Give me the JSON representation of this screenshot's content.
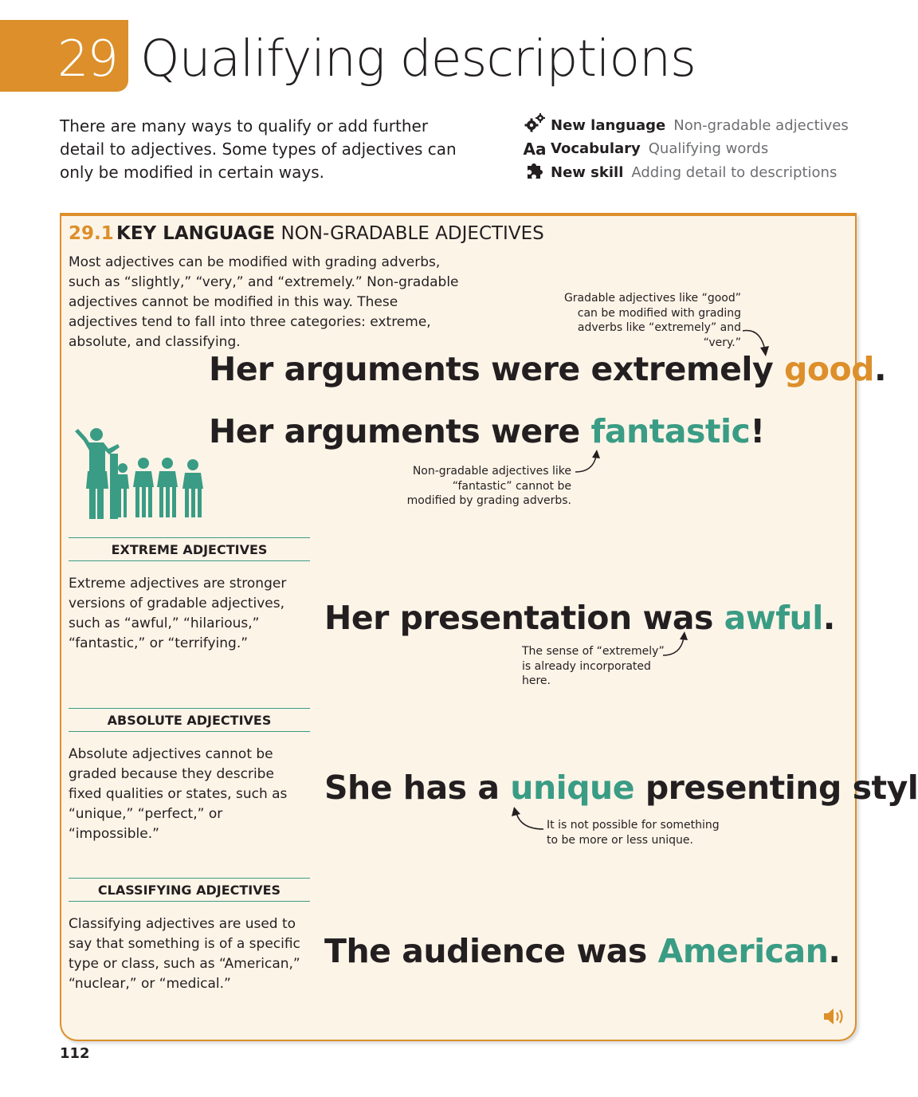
{
  "header": {
    "unit_number": "29",
    "title": "Qualifying descriptions",
    "intro": "There are many ways to qualify or add further detail to adjectives. Some types of adjectives can only be modified in certain ways.",
    "meta": [
      {
        "icon": "gears-icon",
        "key": "New language",
        "value": "Non-gradable adjectives"
      },
      {
        "icon": "aa-icon",
        "icon_text": "Aa",
        "key": "Vocabulary",
        "value": "Qualifying words"
      },
      {
        "icon": "puzzle-icon",
        "key": "New skill",
        "value": "Adding detail to descriptions"
      }
    ]
  },
  "section": {
    "number": "29.1",
    "label": "KEY LANGUAGE",
    "topic": "NON-GRADABLE ADJECTIVES",
    "intro": "Most adjectives can be modified with grading adverbs, such as “slightly,” “very,” and “extremely.” Non-gradable adjectives cannot be modified in this way. These adjectives tend to fall into three categories: extreme, absolute, and classifying.",
    "note_good": "Gradable adjectives like “good” can be modified with grading adverbs like “extremely” and “very.”",
    "sentence1": {
      "before": "Her arguments were extremely ",
      "highlight": "good",
      "after": "."
    },
    "sentence2": {
      "before": "Her arguments were ",
      "highlight": "fantastic",
      "after": "!"
    },
    "note_fantastic": "Non-gradable adjectives like “fantastic” cannot be modified by grading adverbs."
  },
  "categories": [
    {
      "title": "EXTREME ADJECTIVES",
      "text": "Extreme adjectives are stronger versions of gradable adjectives, such as “awful,” “hilarious,” “fantastic,” or “terrifying.”",
      "sentence": {
        "before": "Her presentation was ",
        "highlight": "awful",
        "after": "."
      },
      "note": "The sense of “extremely” is already incorporated here."
    },
    {
      "title": "ABSOLUTE ADJECTIVES",
      "text": "Absolute adjectives cannot be graded because they describe fixed qualities or states, such as “unique,” “perfect,” or “impossible.”",
      "sentence": {
        "before": "She has a ",
        "highlight": "unique",
        "after": " presenting style."
      },
      "note": "It is not possible for something to be more or less unique."
    },
    {
      "title": "CLASSIFYING ADJECTIVES",
      "text": "Classifying adjectives are used to say that something is of a specific type or class, such as “American,” “nuclear,” or “medical.”",
      "sentence": {
        "before": "The audience was ",
        "highlight": "American",
        "after": "."
      }
    }
  ],
  "audio_icon": "speaker-icon",
  "page_number": "112",
  "colors": {
    "accent": "#dc8f2a",
    "teal": "#3a9c84",
    "panel_bg": "#fdf4e8",
    "text": "#231f20"
  }
}
